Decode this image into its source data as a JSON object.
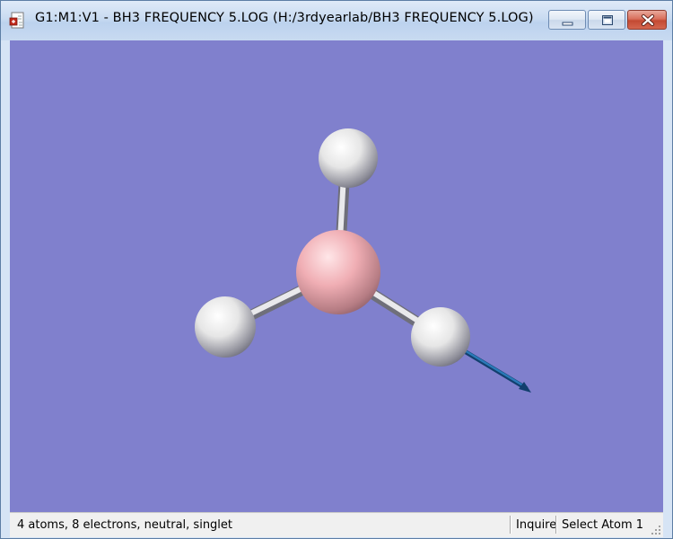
{
  "window": {
    "title": "G1:M1:V1 - BH3 FREQUENCY 5.LOG (H:/3rdyearlab/BH3 FREQUENCY 5.LOG)",
    "icon": "gaussview-document-icon",
    "controls": [
      "minimize",
      "maximize",
      "close"
    ]
  },
  "viewport": {
    "background": "#8080cd",
    "molecule": {
      "atoms": [
        {
          "element": "B",
          "color": "#f2b4b8"
        },
        {
          "element": "H",
          "color": "#f0f0f0"
        },
        {
          "element": "H",
          "color": "#f0f0f0"
        },
        {
          "element": "H",
          "color": "#f0f0f0"
        }
      ],
      "displacement_vector_color": "#1a5f9c"
    }
  },
  "statusbar": {
    "info": "4 atoms, 8 electrons, neutral, singlet",
    "mode": "Inquire",
    "action": "Select Atom 1"
  }
}
